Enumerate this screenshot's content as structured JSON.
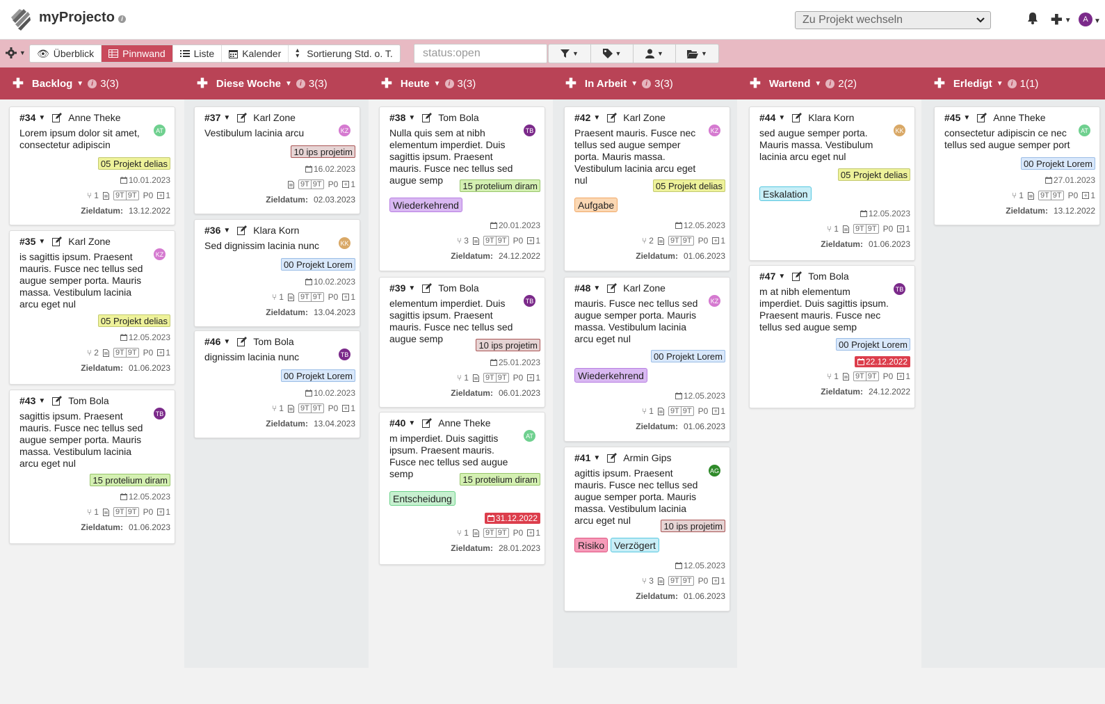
{
  "app": {
    "title": "myProjecto",
    "project_switch_placeholder": "Zu Projekt wechseln",
    "avatar": "A"
  },
  "toolbar": {
    "views": [
      "Überblick",
      "Pinnwand",
      "Liste",
      "Kalender",
      "Sortierung Std. o. T."
    ],
    "active_view": "Pinnwand",
    "search_value": "status:open",
    "filter_icons": [
      "filter-icon",
      "tag-icon",
      "user-icon",
      "folder-icon"
    ]
  },
  "colors": {
    "accent": "#b94356",
    "toolbar": "#e8bac3",
    "overdue": "#dc3e4c"
  },
  "columns": [
    {
      "title": "Backlog",
      "count": "3(3)"
    },
    {
      "title": "Diese Woche",
      "count": "3(3)"
    },
    {
      "title": "Heute",
      "count": "3(3)"
    },
    {
      "title": "In Arbeit",
      "count": "3(3)"
    },
    {
      "title": "Wartend",
      "count": "2(2)"
    },
    {
      "title": "Erledigt",
      "count": "1(1)"
    }
  ],
  "goal_label": "Zieldatum:",
  "cards": [
    {
      "id": "#34",
      "user": "Anne Theke",
      "initials": "AT",
      "desc": "Lorem ipsum dolor sit amet, consectetur adipiscin",
      "project": "05 Projekt delias",
      "date": "10.01.2023",
      "branches": "1",
      "tt1": "9T",
      "tt2": "9T",
      "prio": "P0",
      "sub": "1",
      "goal": "13.12.2022"
    },
    {
      "id": "#35",
      "user": "Karl Zone",
      "initials": "KZ",
      "desc": "is sagittis ipsum. Praesent mauris. Fusce nec tellus sed augue semper porta. Mauris massa. Vestibulum lacinia arcu eget nul",
      "project": "05 Projekt delias",
      "date": "12.05.2023",
      "branches": "2",
      "tt1": "9T",
      "tt2": "9T",
      "prio": "P0",
      "sub": "1",
      "goal": "01.06.2023"
    },
    {
      "id": "#43",
      "user": "Tom Bola",
      "initials": "TB",
      "desc": "sagittis ipsum. Praesent mauris. Fusce nec tellus sed augue semper porta. Mauris massa. Vestibulum lacinia arcu eget nul",
      "project": "15 protelium diram",
      "date": "12.05.2023",
      "branches": "1",
      "tt1": "9T",
      "tt2": "9T",
      "prio": "P0",
      "sub": "1",
      "goal": "01.06.2023"
    },
    {
      "id": "#37",
      "user": "Karl Zone",
      "initials": "KZ",
      "desc": "Vestibulum lacinia arcu",
      "project": "10 ips projetim",
      "date": "16.02.2023",
      "tt1": "9T",
      "tt2": "9T",
      "prio": "P0",
      "sub": "1",
      "goal": "02.03.2023"
    },
    {
      "id": "#36",
      "user": "Klara Korn",
      "initials": "KK",
      "desc": "Sed dignissim lacinia nunc",
      "project": "00 Projekt Lorem",
      "date": "10.02.2023",
      "branches": "1",
      "tt1": "9T",
      "tt2": "9T",
      "prio": "P0",
      "sub": "1",
      "goal": "13.04.2023"
    },
    {
      "id": "#46",
      "user": "Tom Bola",
      "initials": "TB",
      "desc": "dignissim lacinia nunc",
      "project": "00 Projekt Lorem",
      "date": "10.02.2023",
      "branches": "1",
      "tt1": "9T",
      "tt2": "9T",
      "prio": "P0",
      "sub": "1",
      "goal": "13.04.2023"
    },
    {
      "id": "#38",
      "user": "Tom Bola",
      "initials": "TB",
      "desc": "Nulla quis sem at nibh elementum imperdiet. Duis sagittis ipsum. Praesent mauris. Fusce nec tellus sed augue semp",
      "project": "15 protelium diram",
      "label": "Wiederkehrend",
      "date": "20.01.2023",
      "branches": "3",
      "tt1": "9T",
      "tt2": "9T",
      "prio": "P0",
      "sub": "1",
      "goal": "24.12.2022"
    },
    {
      "id": "#39",
      "user": "Tom Bola",
      "initials": "TB",
      "desc": "elementum imperdiet. Duis sagittis ipsum. Praesent mauris. Fusce nec tellus sed augue semp",
      "project": "10 ips projetim",
      "date": "25.01.2023",
      "branches": "1",
      "tt1": "9T",
      "tt2": "9T",
      "prio": "P0",
      "sub": "1",
      "goal": "06.01.2023"
    },
    {
      "id": "#40",
      "user": "Anne Theke",
      "initials": "AT",
      "desc": "m imperdiet. Duis sagittis ipsum. Praesent mauris. Fusce nec tellus sed augue semp",
      "project": "15 protelium diram",
      "label": "Entscheidung",
      "date": "31.12.2022",
      "branches": "1",
      "tt1": "9T",
      "tt2": "9T",
      "prio": "P0",
      "sub": "1",
      "goal": "28.01.2023"
    },
    {
      "id": "#42",
      "user": "Karl Zone",
      "initials": "KZ",
      "desc": "Praesent mauris. Fusce nec tellus sed augue semper porta. Mauris massa. Vestibulum lacinia arcu eget nul",
      "project": "05 Projekt delias",
      "label": "Aufgabe",
      "date": "12.05.2023",
      "branches": "2",
      "tt1": "9T",
      "tt2": "9T",
      "prio": "P0",
      "sub": "1",
      "goal": "01.06.2023"
    },
    {
      "id": "#48",
      "user": "Karl Zone",
      "initials": "KZ",
      "desc": "mauris. Fusce nec tellus sed augue semper porta. Mauris massa. Vestibulum lacinia arcu eget nul",
      "project": "00 Projekt Lorem",
      "label": "Wiederkehrend",
      "date": "12.05.2023",
      "branches": "1",
      "tt1": "9T",
      "tt2": "9T",
      "prio": "P0",
      "sub": "1",
      "goal": "01.06.2023"
    },
    {
      "id": "#41",
      "user": "Armin Gips",
      "initials": "AG",
      "desc": "agittis ipsum. Praesent mauris. Fusce nec tellus sed augue semper porta. Mauris massa. Vestibulum lacinia arcu eget nul",
      "project": "10 ips projetim",
      "label": "Risiko",
      "label2": "Verzögert",
      "date": "12.05.2023",
      "branches": "3",
      "tt1": "9T",
      "tt2": "9T",
      "prio": "P0",
      "sub": "1",
      "goal": "01.06.2023"
    },
    {
      "id": "#44",
      "user": "Klara Korn",
      "initials": "KK",
      "desc": "sed augue semper porta. Mauris massa. Vestibulum lacinia arcu eget nul",
      "project": "05 Projekt delias",
      "label": "Eskalation",
      "date": "12.05.2023",
      "branches": "1",
      "tt1": "9T",
      "tt2": "9T",
      "prio": "P0",
      "sub": "1",
      "goal": "01.06.2023"
    },
    {
      "id": "#47",
      "user": "Tom Bola",
      "initials": "TB",
      "desc": "m at nibh elementum imperdiet. Duis sagittis ipsum. Praesent mauris. Fusce nec tellus sed augue semp",
      "project": "00 Projekt Lorem",
      "date": "22.12.2022",
      "branches": "1",
      "tt1": "9T",
      "tt2": "9T",
      "prio": "P0",
      "sub": "1",
      "goal": "24.12.2022"
    },
    {
      "id": "#45",
      "user": "Anne Theke",
      "initials": "AT",
      "desc": "consectetur adipiscin ce nec tellus sed augue semper port",
      "project": "00 Projekt Lorem",
      "date": "27.01.2023",
      "branches": "1",
      "tt1": "9T",
      "tt2": "9T",
      "prio": "P0",
      "sub": "1",
      "goal": "13.12.2022"
    }
  ]
}
